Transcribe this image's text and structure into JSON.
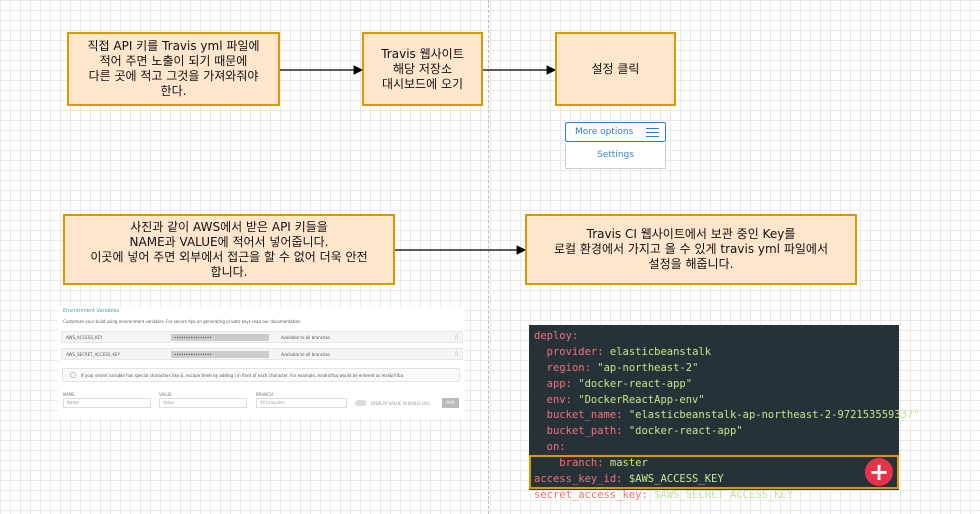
{
  "flow_top": {
    "step1": "직접 API 키를 Travis yml 파일에\n적어 주면 노출이 되기 때문에\n다른 곳에 적고 그것을 가져와줘야\n한다.",
    "step2": "Travis 웹사이트\n해당 저장소\n대시보드에 오기",
    "step3": "설정 클릭"
  },
  "settings_widget": {
    "more_options": "More options",
    "settings": "Settings"
  },
  "flow_bottom": {
    "step4": "사진과 같이 AWS에서 받은 API 키들을\nNAME과 VALUE에 적어서 넣어줍니다.\n이곳에 넣어 주면 외부에서 접근을 할 수 없어 더욱 안전\n합니다.",
    "step5": "Travis CI 웹사이트에서 보관 중인 Key를\n로컬 환경에서 가지고 올 수 있게 travis yml 파일에서\n설정을 해줍니다."
  },
  "env_panel": {
    "title": "Environment Variables",
    "description": "Customize your build using environment variables. For secure tips on generating private keys read our documentation",
    "rows": [
      {
        "name": "AWS_ACCESS_KEY",
        "value": "••••••••••••••••",
        "branch": "Available to all branches"
      },
      {
        "name": "AWS_SECRET_ACCESS_KEY",
        "value": "••••••••••••••••",
        "branch": "Available to all branches"
      }
    ],
    "note": "If your secret variable has special characters like &, escape them by adding \\ in front of each character. For example, madrid!ba would be entered as ma\\&ri\\!ba",
    "form": {
      "name_label": "NAME",
      "name_placeholder": "Name",
      "value_label": "VALUE",
      "value_placeholder": "Value",
      "branch_label": "BRANCH",
      "branch_value": "All branches",
      "display_label": "DISPLAY VALUE IN BUILD LOG",
      "add_button": "Add"
    }
  },
  "code": [
    {
      "indent": "",
      "key": "deploy:",
      "value": ""
    },
    {
      "indent": "  ",
      "key": "provider:",
      "value": " elasticbeanstalk"
    },
    {
      "indent": "  ",
      "key": "region:",
      "value": " \"ap-northeast-2\""
    },
    {
      "indent": "  ",
      "key": "app:",
      "value": " \"docker-react-app\""
    },
    {
      "indent": "  ",
      "key": "env:",
      "value": " \"DockerReactApp-env\""
    },
    {
      "indent": "  ",
      "key": "bucket_name:",
      "value": " \"elasticbeanstalk-ap-northeast-2-972153559337\""
    },
    {
      "indent": "  ",
      "key": "bucket_path:",
      "value": " \"docker-react-app\""
    },
    {
      "indent": "  ",
      "key": "on:",
      "value": ""
    },
    {
      "indent": "    ",
      "key": "branch:",
      "value": " master"
    },
    {
      "indent": "",
      "key": "access_key_id:",
      "value": " $AWS_ACCESS_KEY"
    },
    {
      "indent": "",
      "key": "secret_access_key:",
      "value": " $AWS_SECRET_ACCESS_KEY"
    }
  ],
  "plus_icon": "+",
  "colors": {
    "box_fill": "#ffe6cc",
    "box_border": "#d79b00",
    "code_bg": "#273238",
    "code_key": "#f07178",
    "code_value": "#c3e88d",
    "plus": "#e8334d"
  }
}
